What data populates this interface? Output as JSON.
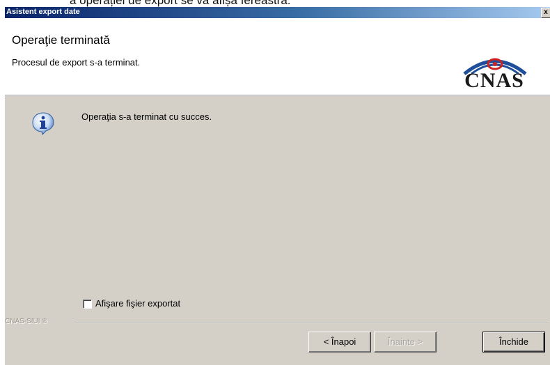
{
  "document_caption": "a operației de export se va afișa fereastra:",
  "window": {
    "title": "Asistent export date",
    "close_glyph": "x"
  },
  "header": {
    "title": "Operaţie terminată",
    "subtitle": "Procesul de export s-a terminat.",
    "logo_text": "CNAS"
  },
  "body": {
    "info_icon": "info-icon",
    "message": "Operaţia s-a terminat cu succes.",
    "checkbox_label": "Afişare fişier exportat",
    "checkbox_checked": false
  },
  "footer": {
    "brand": "CNAS-SIUI ®",
    "buttons": {
      "back": "< Înapoi",
      "next": "Înainte >",
      "close": "Închide"
    },
    "next_disabled": true
  },
  "colors": {
    "titlebar_start": "#0a246a",
    "titlebar_end": "#a6caf0",
    "dialog_bg": "#d4d0c8",
    "logo_red": "#cc2222",
    "logo_blue": "#1f4f9a"
  }
}
